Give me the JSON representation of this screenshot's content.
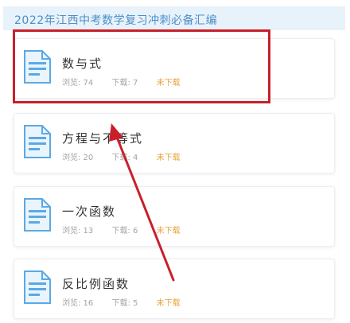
{
  "header": {
    "title": "2022年江西中考数学复习冲刺必备汇编"
  },
  "items": [
    {
      "title": "数与式",
      "views_label": "浏览: 74",
      "downloads_label": "下载: 7",
      "status": "未下载"
    },
    {
      "title": "方程与不等式",
      "views_label": "浏览: 20",
      "downloads_label": "下载: 4",
      "status": "未下载"
    },
    {
      "title": "一次函数",
      "views_label": "浏览: 13",
      "downloads_label": "下载: 6",
      "status": "未下载"
    },
    {
      "title": "反比例函数",
      "views_label": "浏览: 16",
      "downloads_label": "下载: 5",
      "status": "未下载"
    }
  ],
  "icons": {
    "document": "document-icon"
  },
  "colors": {
    "header_bg": "#e8f2fa",
    "header_text": "#4a90c8",
    "status_text": "#e8a33c",
    "annotation": "#c8202a",
    "icon_blue": "#5aa9e6"
  }
}
